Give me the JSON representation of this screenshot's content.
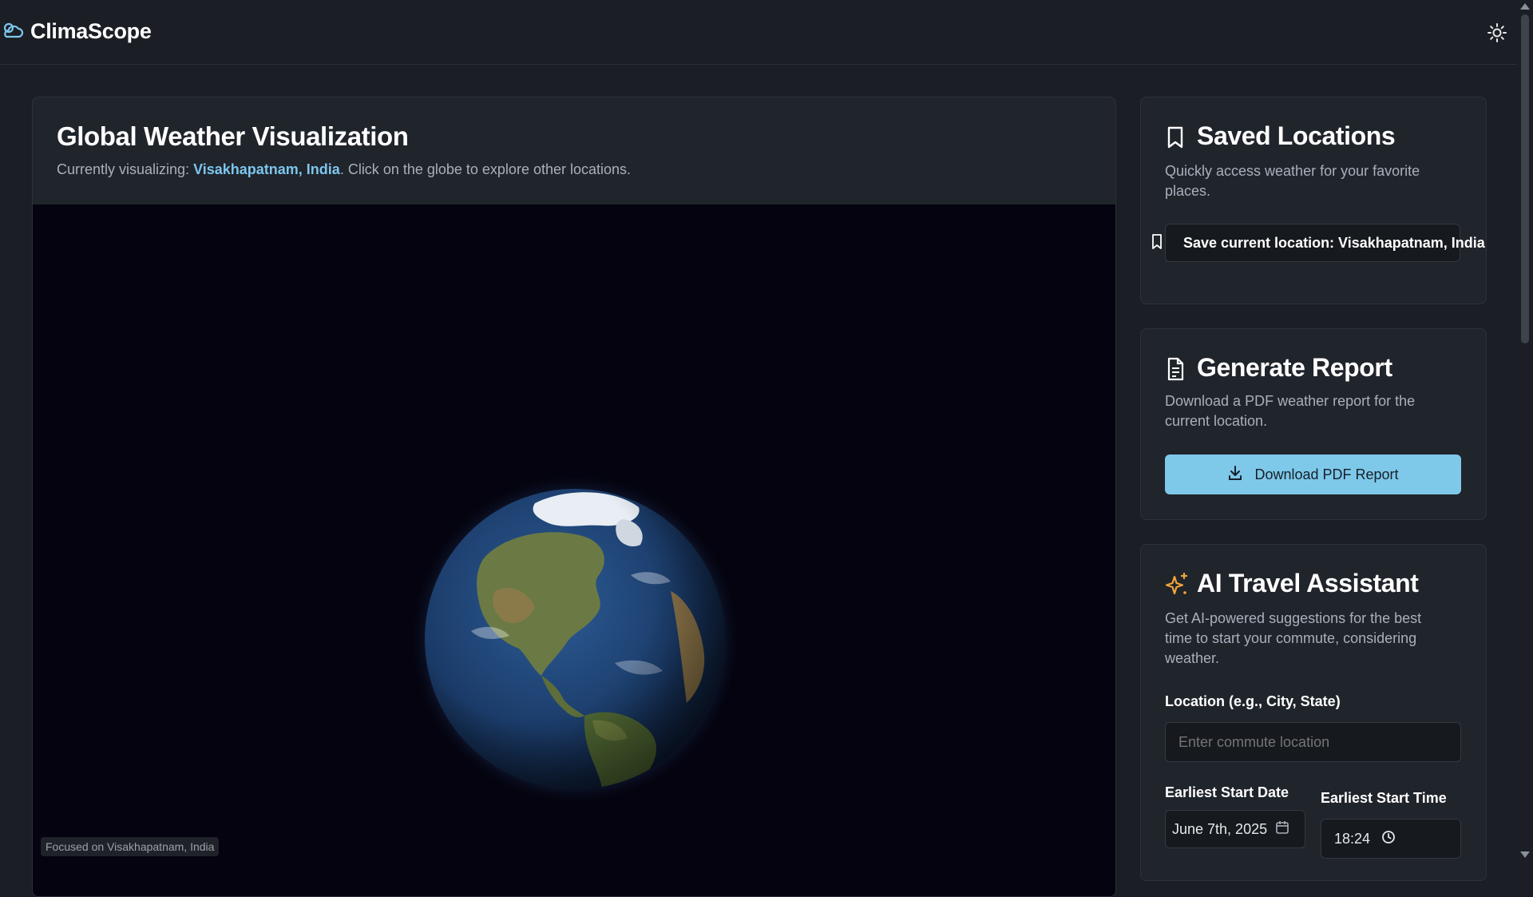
{
  "app": {
    "name": "ClimaScope"
  },
  "header": {
    "theme_toggle_icon": "sun-icon",
    "logo_icon": "cloud-sun-icon"
  },
  "main": {
    "title": "Global Weather Visualization",
    "subtitle_prefix": "Currently visualizing: ",
    "location": "Visakhapatnam, India",
    "subtitle_suffix": ". Click on the globe to explore other locations.",
    "status": "Focused on Visakhapatnam, India"
  },
  "saved": {
    "title": "Saved Locations",
    "description": "Quickly access weather for your favorite places.",
    "save_button": "Save current location: Visakhapatnam, India",
    "icon": "bookmark-icon"
  },
  "report": {
    "title": "Generate Report",
    "description": "Download a PDF weather report for the current location.",
    "button": "Download PDF Report",
    "icon": "file-text-icon",
    "button_icon": "download-icon"
  },
  "ai": {
    "title": "AI Travel Assistant",
    "description": "Get AI-powered suggestions for the best time to start your commute, considering weather.",
    "location_label": "Location (e.g., City, State)",
    "location_placeholder": "Enter commute location",
    "date_label": "Earliest Start Date",
    "date_value": "June 7th, 2025",
    "time_label": "Earliest Start Time",
    "time_value": "18:24",
    "icon": "sparkles-icon"
  },
  "colors": {
    "accent": "#7cc6ee",
    "button": "#7ec8e9",
    "background": "#1b1e24",
    "card": "#20242b",
    "sparkle": "#f0a53a"
  }
}
